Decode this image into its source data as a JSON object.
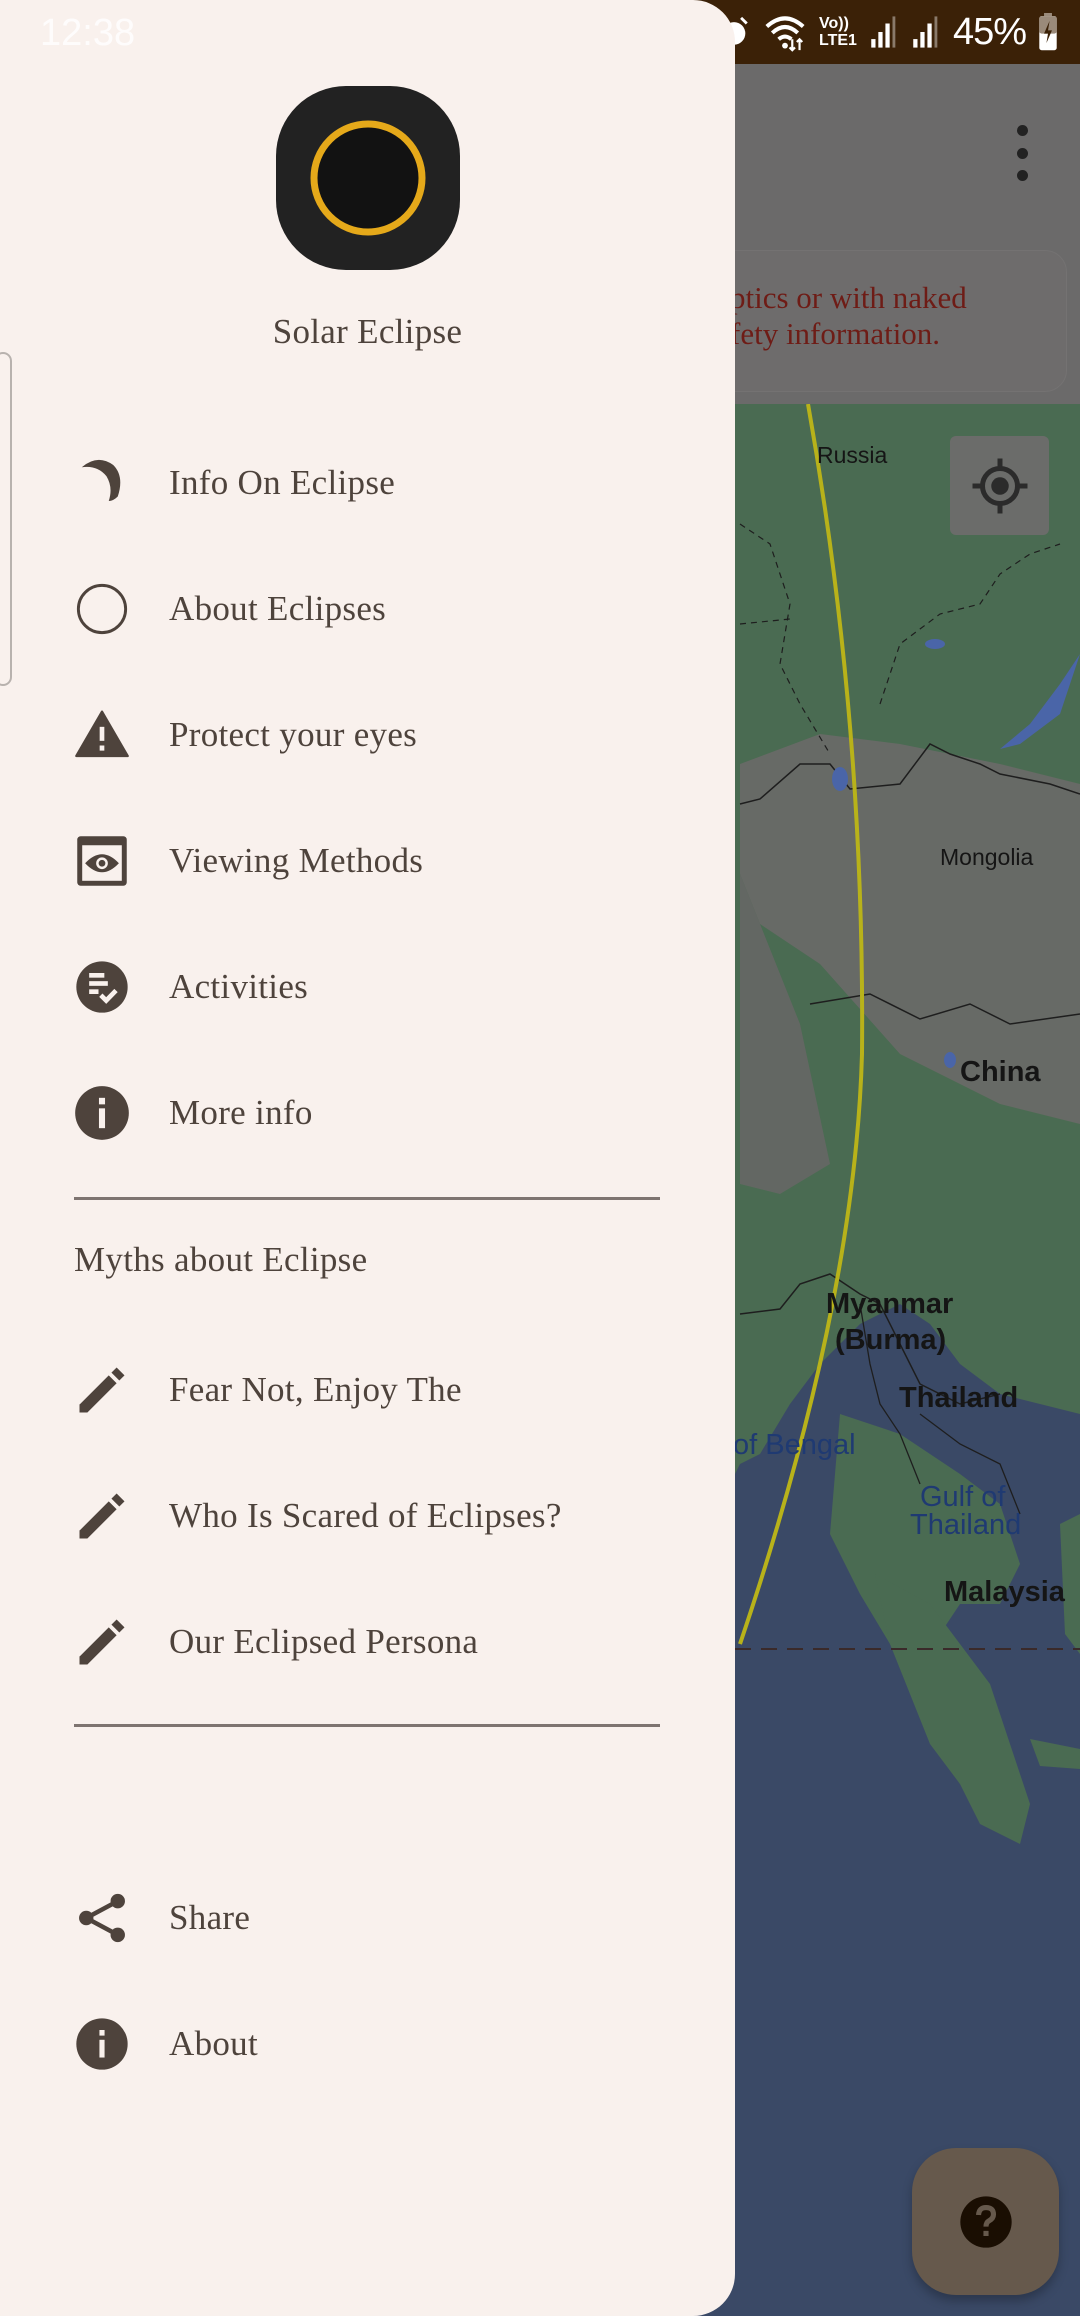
{
  "status_bar": {
    "time": "12:38",
    "icons": [
      "alarm-icon",
      "wifi-icon",
      "volte-lte1-icon",
      "signal-1-icon",
      "signal-2-icon",
      "battery-charging-icon"
    ],
    "volte_top": "Vo))",
    "volte_bottom": "LTE1",
    "battery_percent": "45%"
  },
  "drawer": {
    "app_name": "Solar Eclipse",
    "logo": {
      "ring_color": "#e5a91a",
      "bg_color": "#222222"
    },
    "main_items": [
      {
        "id": "info-on-eclipse",
        "label": "Info On Eclipse",
        "icon": "crescent-moon-icon"
      },
      {
        "id": "about-eclipses",
        "label": "About Eclipses",
        "icon": "circle-outline-icon"
      },
      {
        "id": "protect-your-eyes",
        "label": "Protect your eyes",
        "icon": "warning-icon"
      },
      {
        "id": "viewing-methods",
        "label": "Viewing Methods",
        "icon": "eye-window-icon"
      },
      {
        "id": "activities",
        "label": "Activities",
        "icon": "checklist-icon"
      },
      {
        "id": "more-info",
        "label": "More info",
        "icon": "info-icon"
      }
    ],
    "myths_section_title": "Myths about Eclipse",
    "myth_items": [
      {
        "id": "fear-not",
        "label": "Fear Not, Enjoy The",
        "icon": "pencil-icon"
      },
      {
        "id": "who-is-scared",
        "label": "Who Is Scared of Eclipses?",
        "icon": "pencil-icon"
      },
      {
        "id": "eclipsed-persona",
        "label": "Our Eclipsed Persona",
        "icon": "pencil-icon"
      }
    ],
    "footer_items": [
      {
        "id": "share",
        "label": "Share",
        "icon": "share-icon"
      },
      {
        "id": "about",
        "label": "About",
        "icon": "info-icon"
      }
    ]
  },
  "background": {
    "warning_text_line1": "ptics or with naked",
    "warning_text_line2": "fety information.",
    "map_labels": {
      "russia": "Russia",
      "mongolia": "Mongolia",
      "china": "China",
      "myanmar": "Myanmar",
      "burma": "(Burma)",
      "thailand": "Thailand",
      "bay_of_bengal": "of Bengal",
      "gulf_of": "Gulf of",
      "gulf_thailand": "Thailand",
      "malaysia": "Malaysia",
      "cut_label": "l"
    },
    "colors": {
      "eclipse_path": "#b8b21a",
      "water": "#3a4966",
      "land": "#4a6b52",
      "scrim": "rgba(0,0,0,0.45)"
    }
  }
}
